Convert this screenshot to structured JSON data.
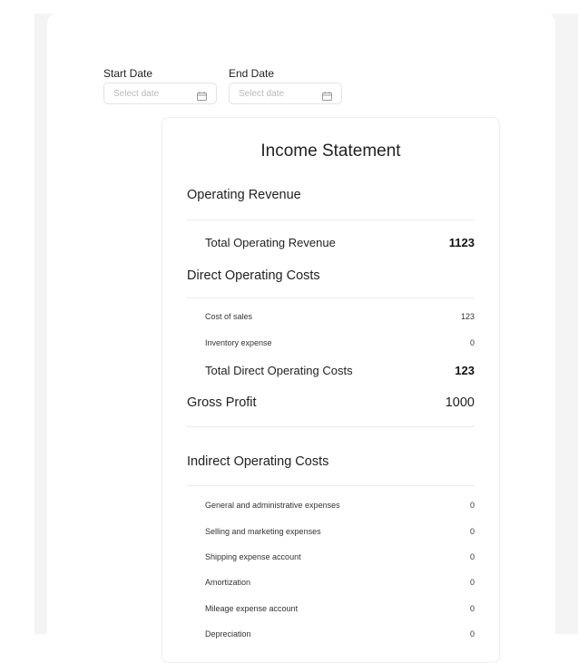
{
  "filters": {
    "start_label": "Start Date",
    "start_placeholder": "Select date",
    "end_label": "End Date",
    "end_placeholder": "Select date"
  },
  "statement": {
    "title": "Income Statement",
    "operating_revenue": {
      "heading": "Operating Revenue",
      "total_label": "Total Operating Revenue",
      "total_value": "1123"
    },
    "direct_costs": {
      "heading": "Direct Operating Costs",
      "items": [
        {
          "label": "Cost of sales",
          "value": "123"
        },
        {
          "label": "Inventory expense",
          "value": "0"
        }
      ],
      "total_label": "Total Direct Operating Costs",
      "total_value": "123"
    },
    "gross_profit": {
      "label": "Gross Profit",
      "value": "1000"
    },
    "indirect_costs": {
      "heading": "Indirect Operating Costs",
      "items": [
        {
          "label": "General and administrative expenses",
          "value": "0"
        },
        {
          "label": "Selling and marketing expenses",
          "value": "0"
        },
        {
          "label": "Shipping expense account",
          "value": "0"
        },
        {
          "label": "Amortization",
          "value": "0"
        },
        {
          "label": "Mileage expense account",
          "value": "0"
        },
        {
          "label": "Depreciation",
          "value": "0"
        }
      ]
    }
  },
  "icons": {
    "date_picker": "calendar-icon"
  },
  "colors": {
    "page_background": "#f4f4f5",
    "card_background": "#ffffff",
    "divider": "#ececec",
    "placeholder": "#b9b9b9"
  }
}
